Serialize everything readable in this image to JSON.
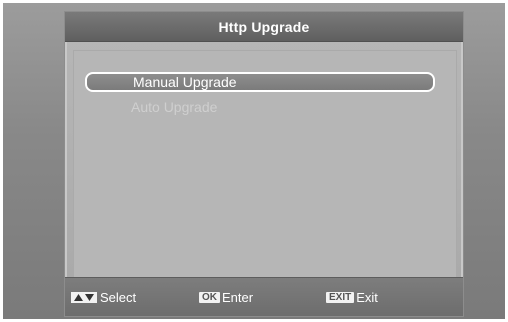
{
  "dialog": {
    "title": "Http Upgrade"
  },
  "menu": {
    "items": [
      {
        "label": "Manual Upgrade",
        "state": "selected"
      },
      {
        "label": "Auto Upgrade",
        "state": "disabled"
      }
    ]
  },
  "footer": {
    "select": {
      "key_icon": "up-down-arrows-icon",
      "label": "Select"
    },
    "enter": {
      "key": "OK",
      "label": "Enter"
    },
    "exit": {
      "key": "EXIT",
      "label": "Exit"
    }
  },
  "colors": {
    "title_bar": "#6a6a6a",
    "selected_border": "#ffffff",
    "disabled_text": "#cfcfcf"
  }
}
